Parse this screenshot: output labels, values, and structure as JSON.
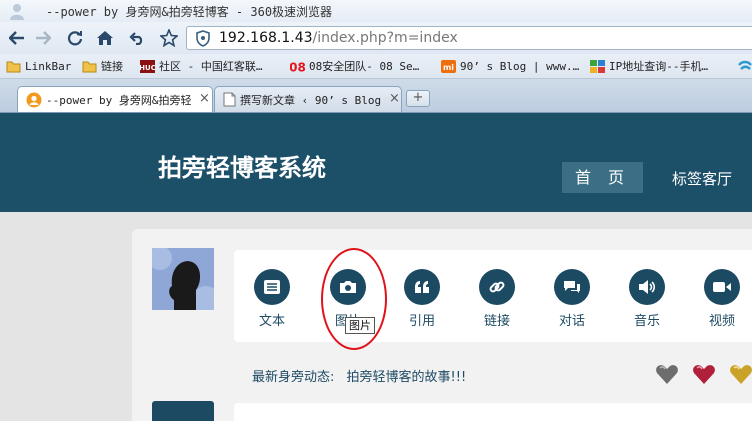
{
  "window": {
    "title": "--power by 身旁网&拍旁轻博客 - 360极速浏览器"
  },
  "address_bar": {
    "url_host": "192.168.1.43",
    "url_path": "/index.php?m=index"
  },
  "bookmarks": [
    {
      "label": "LinkBar",
      "icon": "folder-icon"
    },
    {
      "label": "链接",
      "icon": "folder-icon"
    },
    {
      "label": "社区 - 中国红客联…",
      "icon": "huc-icon"
    },
    {
      "label": "08安全团队- 08 Se…",
      "icon": "08-icon"
    },
    {
      "label": "90’ s Blog | www.…",
      "icon": "mi-icon"
    },
    {
      "label": "IP地址查询--手机…",
      "icon": "ip-puzzle-icon"
    }
  ],
  "tabs": [
    {
      "label": "--power by 身旁网&拍旁轻",
      "active": true
    },
    {
      "label": "撰写新文章 ‹ 90’ s Blog",
      "active": false
    }
  ],
  "site": {
    "title": "拍旁轻博客系统",
    "nav": {
      "home": "首 页",
      "tags": "标签客厅"
    }
  },
  "post_types": [
    {
      "label": "文本",
      "icon": "text-list-icon"
    },
    {
      "label": "图片",
      "icon": "camera-icon"
    },
    {
      "label": "引用",
      "icon": "quote-icon"
    },
    {
      "label": "链接",
      "icon": "link-icon"
    },
    {
      "label": "对话",
      "icon": "chat-icon"
    },
    {
      "label": "音乐",
      "icon": "speaker-icon"
    },
    {
      "label": "视频",
      "icon": "video-icon"
    }
  ],
  "tooltip": "图片",
  "news": {
    "label": "最新身旁动态:",
    "link": "拍旁轻博客的故事!!!"
  },
  "colors": {
    "header": "#1c4f68",
    "accent": "#1d4a63",
    "annotation": "#e0121a"
  }
}
